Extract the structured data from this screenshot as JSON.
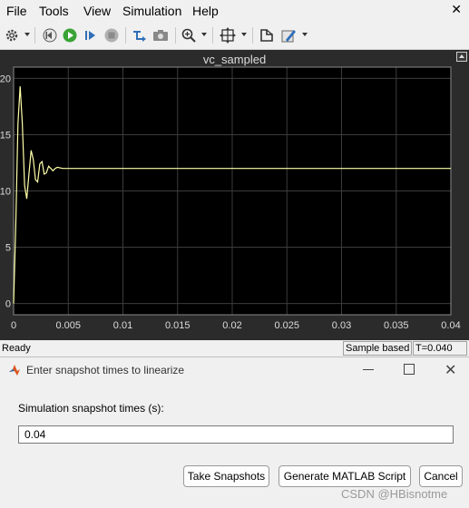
{
  "menubar": {
    "items": [
      "File",
      "Tools",
      "View",
      "Simulation",
      "Help"
    ]
  },
  "toolbar": {
    "icons": [
      "gear-icon",
      "back-icon",
      "run-icon",
      "step-forward-icon",
      "stop-icon",
      "select-signal-icon",
      "camera-icon",
      "zoom-icon",
      "fit-to-view-icon",
      "cursor-icon",
      "style-icon"
    ]
  },
  "scope": {
    "title": "vc_sampled"
  },
  "chart_data": {
    "type": "line",
    "title": "vc_sampled",
    "xlim": [
      0,
      0.04
    ],
    "ylim": [
      -1,
      21
    ],
    "x_ticks": [
      "0",
      "0.005",
      "0.01",
      "0.015",
      "0.02",
      "0.025",
      "0.03",
      "0.035",
      "0.04"
    ],
    "y_ticks": [
      "0",
      "5",
      "10",
      "15",
      "20"
    ],
    "grid": true,
    "series": [
      {
        "color": "#ffffaa",
        "points": [
          [
            0,
            0
          ],
          [
            0.0002,
            7
          ],
          [
            0.0004,
            16
          ],
          [
            0.0006,
            19.3
          ],
          [
            0.0008,
            16
          ],
          [
            0.001,
            10.5
          ],
          [
            0.0012,
            9.3
          ],
          [
            0.0014,
            11.5
          ],
          [
            0.0016,
            13.6
          ],
          [
            0.0018,
            12.8
          ],
          [
            0.002,
            11.0
          ],
          [
            0.0022,
            10.8
          ],
          [
            0.0024,
            12.4
          ],
          [
            0.0026,
            12.6
          ],
          [
            0.0028,
            11.5
          ],
          [
            0.003,
            11.6
          ],
          [
            0.0032,
            12.2
          ],
          [
            0.0034,
            12.0
          ],
          [
            0.0036,
            11.8
          ],
          [
            0.0038,
            12.0
          ],
          [
            0.004,
            12.1
          ],
          [
            0.0045,
            12.0
          ],
          [
            0.005,
            12
          ],
          [
            0.04,
            12
          ]
        ]
      }
    ]
  },
  "status": {
    "ready": "Ready",
    "mode": "Sample based",
    "time": "T=0.040"
  },
  "dialog": {
    "title": "Enter snapshot times to linearize",
    "label": "Simulation snapshot times (s):",
    "input_value": "0.04",
    "buttons": {
      "take": "Take Snapshots",
      "generate": "Generate MATLAB Script",
      "cancel": "Cancel"
    }
  },
  "watermark": "CSDN @HBisnotme"
}
